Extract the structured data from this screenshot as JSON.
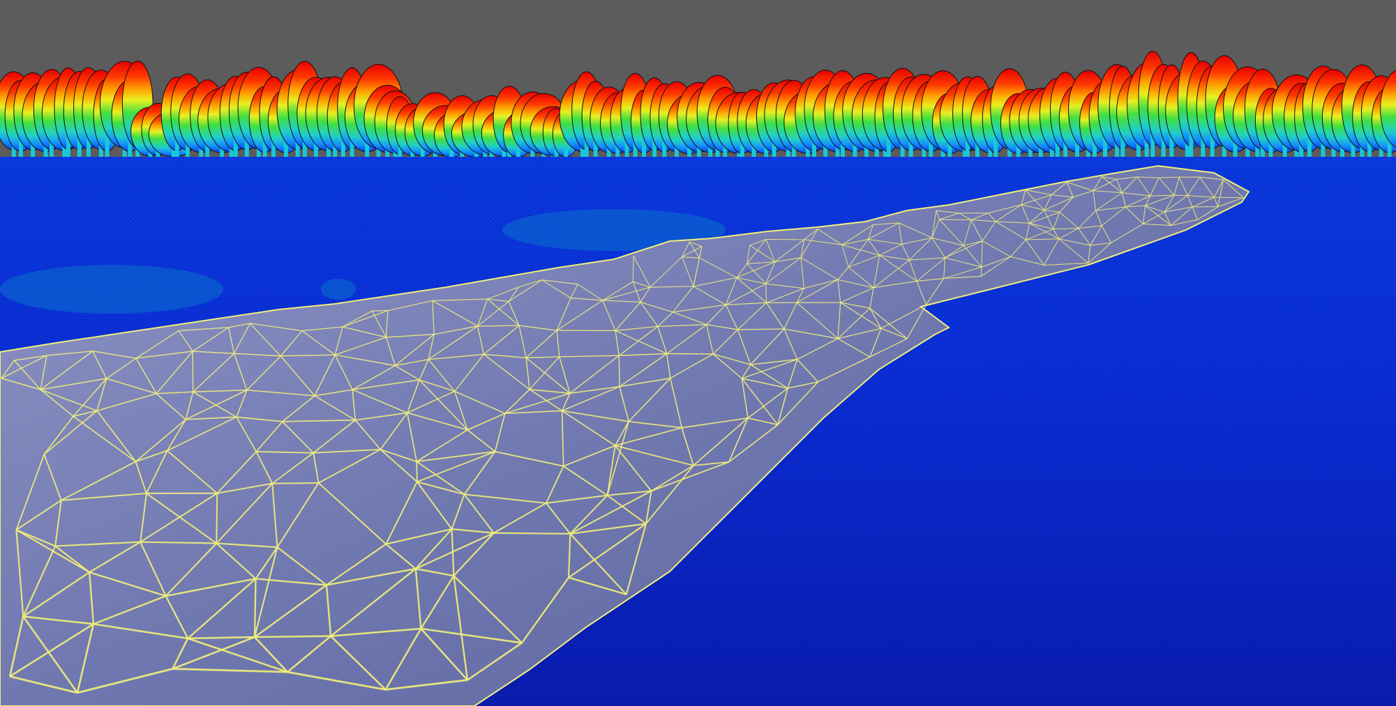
{
  "viewer": {
    "background_color": "#5c5c5c",
    "color_ramp": [
      "#0a1a8a",
      "#0a2fd8",
      "#1060ff",
      "#19c8e8",
      "#22dd66",
      "#d7f51f",
      "#ffb000",
      "#ff2a00",
      "#e80000"
    ],
    "ground_color": "#0a2fd8",
    "ground_color_far": "#0a1fb4",
    "mesh_fill": "#7d83b8",
    "mesh_wire_color": "#f2f07a"
  }
}
